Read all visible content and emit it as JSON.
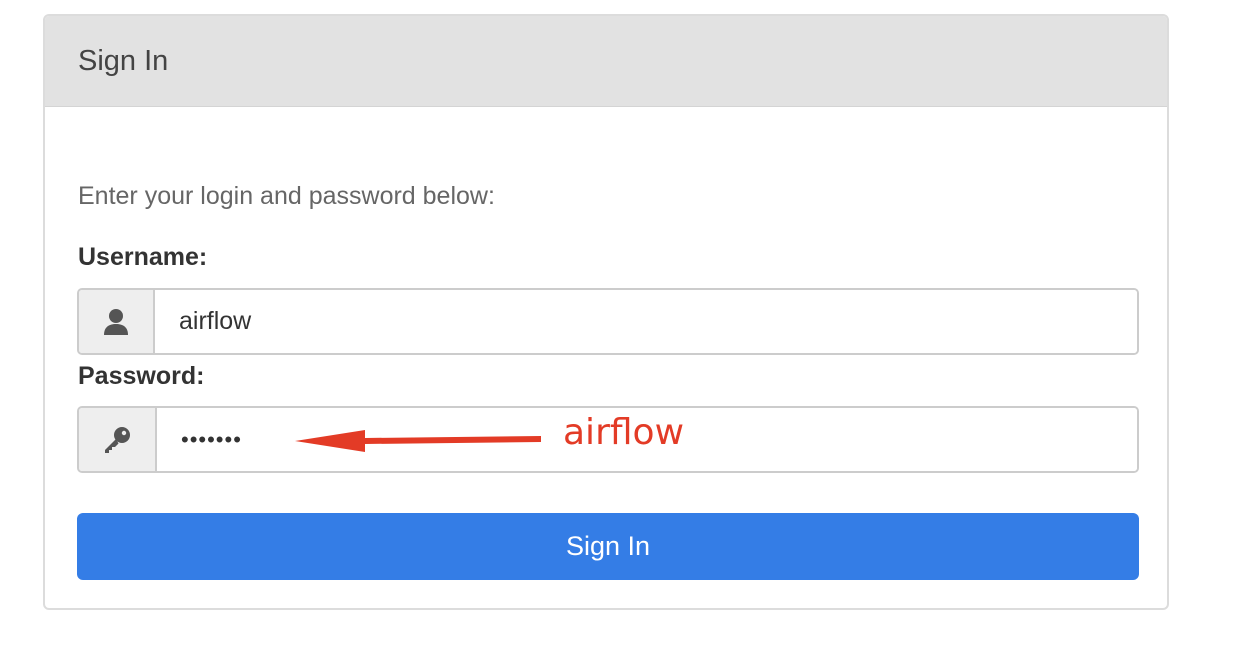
{
  "panel": {
    "title": "Sign In"
  },
  "form": {
    "intro": "Enter your login and password below:",
    "username_label": "Username:",
    "username_value": "airflow",
    "password_label": "Password:",
    "password_value": "•••••••",
    "submit_label": "Sign In"
  },
  "annotation": {
    "text": "airflow",
    "color": "#e33b26"
  },
  "icons": {
    "username": "user-icon",
    "password": "key-icon"
  },
  "colors": {
    "primary_button": "#347de6",
    "panel_heading_bg": "#e2e2e2",
    "addon_bg": "#eeeeee"
  }
}
